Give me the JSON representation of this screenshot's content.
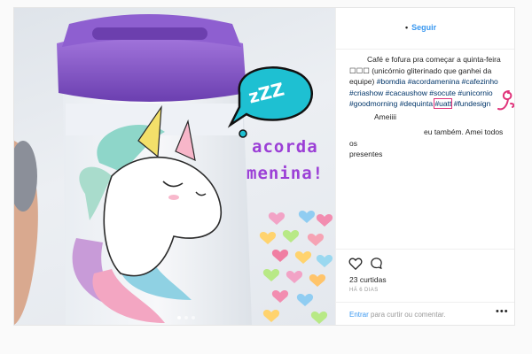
{
  "header": {
    "follow_label": "Seguir"
  },
  "photo": {
    "zzz": "zZZ",
    "doodle_line1": "acorda",
    "doodle_line2": "menina!"
  },
  "caption": {
    "text_plain": "Café e fofura pra começar a quinta-feira ☐☐☐ (unicórnio gliterinado que ganhei da equipe)",
    "hashtags_a": "#bomdia #acordamenina #cafezinho #criashow #cacaushow #socute #unicornio #goodmorning #dequinta",
    "hashtag_boxed": "#uatt",
    "hashtag_last": "#fundesign"
  },
  "comments": [
    {
      "text": "Ameiiii"
    },
    {
      "text_a": "eu também. Amei todos os",
      "text_b": "presentes"
    }
  ],
  "actions": {
    "like_icon": "heart-icon",
    "comment_icon": "comment-icon"
  },
  "likes_label": "23 curtidas",
  "date_label": "HÁ 6 DIAS",
  "comment_bar": {
    "login_label": "Entrar",
    "login_rest": "para curtir ou comentar.",
    "more_label": "•••"
  },
  "colors": {
    "link": "#3897f0",
    "hashtag": "#003569",
    "accent_pink": "#e0337a",
    "lid_purple": "#8b5cc7",
    "doodle_purple": "#9b3fd6",
    "bubble_teal": "#1ec0d2"
  }
}
